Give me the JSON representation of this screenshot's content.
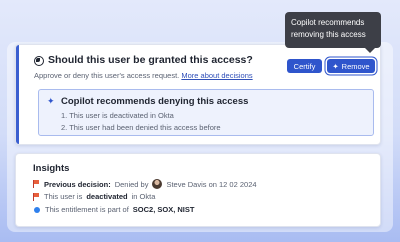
{
  "tooltip": {
    "text": "Copilot recommends removing this access"
  },
  "question": {
    "title": "Should this user be granted this access?",
    "subtitle": "Approve or deny this user's access request.",
    "link": "More about decisions"
  },
  "actions": {
    "certify_label": "Certify",
    "remove_label": "Remove"
  },
  "recommendation": {
    "title": "Copilot recommends denying this access",
    "reasons": [
      "1. This user is deactivated in Okta",
      "2. This user had been denied this access before"
    ]
  },
  "insights": {
    "title": "Insights",
    "previous_decision_label": "Previous decision:",
    "previous_decision_text": "Denied by",
    "previous_decision_person": "Steve Davis on 12 02 2024",
    "status_prefix": "This user is",
    "status_value": "deactivated",
    "status_suffix": "in Okta",
    "entitlement_prefix": "This entitlement is part of",
    "entitlement_value": "SOC2, SOX, NIST"
  },
  "colors": {
    "accent": "#2f55cc",
    "tooltip_bg": "#3d3f47",
    "flag": "#e8603c"
  }
}
